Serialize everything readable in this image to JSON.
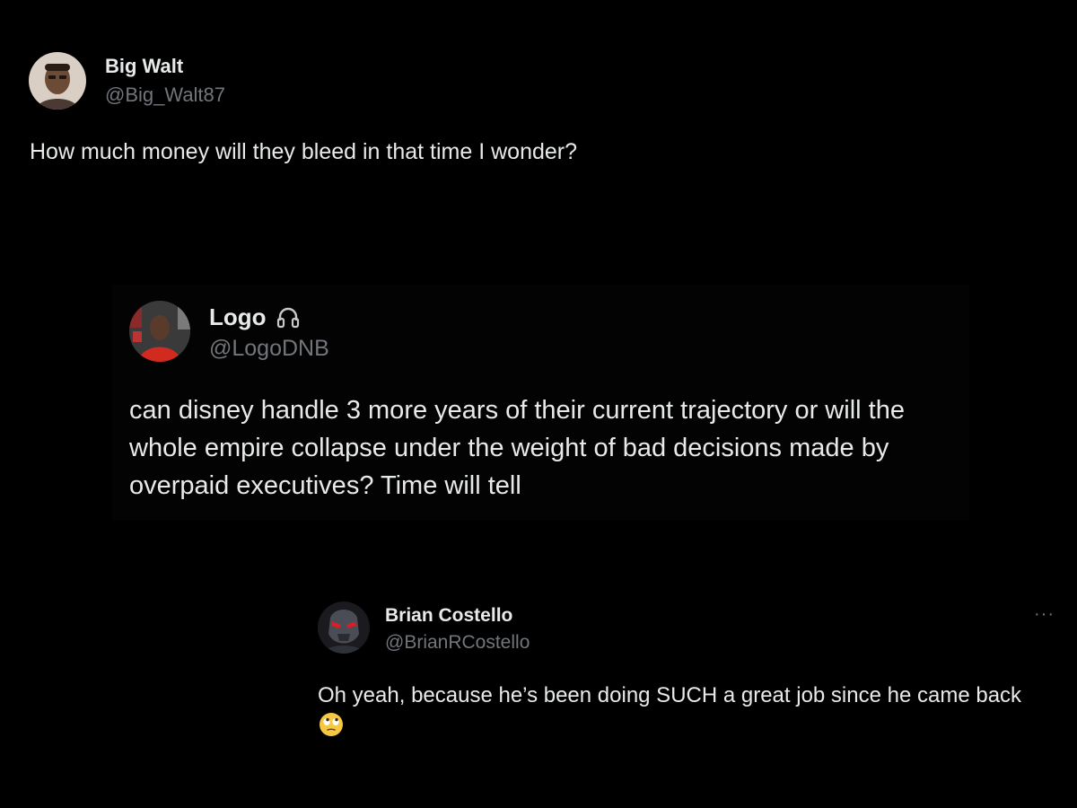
{
  "tweets": [
    {
      "display_name": "Big Walt",
      "handle": "@Big_Walt87",
      "avatar_icon": "user-photo-avatar",
      "text": "How much money will they bleed in that time I wonder?"
    },
    {
      "display_name": "Logo",
      "name_badge_icon": "headphones-icon",
      "handle": "@LogoDNB",
      "avatar_icon": "user-photo-avatar",
      "text": "can disney handle 3 more years of their current trajectory or will the whole empire collapse under the weight of bad decisions made by overpaid executives? Time will tell"
    },
    {
      "display_name": "Brian Costello",
      "handle": "@BrianRCostello",
      "avatar_icon": "masked-character-avatar",
      "more_label": "···",
      "text": "Oh yeah, because he’s been doing SUCH a great job since he came back",
      "trailing_emoji": "face-with-rolling-eyes-emoji"
    }
  ],
  "colors": {
    "background": "#000000",
    "primary_text": "#e7e9ea",
    "secondary_text": "#71767b"
  }
}
